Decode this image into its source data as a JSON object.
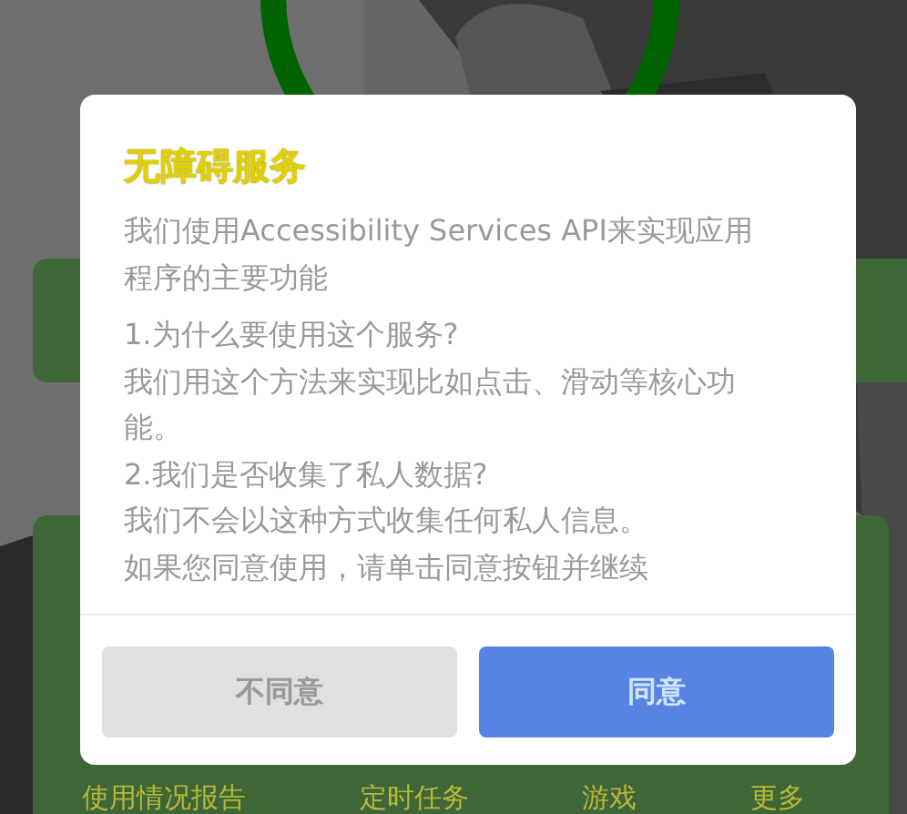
{
  "background": {
    "nav_items": [
      "使用情况报告",
      "定时任务",
      "游戏",
      "更多"
    ]
  },
  "dialog": {
    "title": "无障碍服务",
    "paragraphs": [
      [
        "我们使用Accessibility Services API来实现应用程序的主要功能"
      ],
      [
        "1.为什么要使用这个服务?",
        "我们用这个方法来实现比如点击、滑动等核心功能。",
        "2.我们是否收集了私人数据?",
        "我们不会以这种方式收集任何私人信息。",
        "如果您同意使用，请单击同意按钮并继续"
      ]
    ],
    "buttons": [
      {
        "label": "不同意",
        "kind": "secondary"
      },
      {
        "label": "同意",
        "kind": "primary"
      }
    ]
  }
}
